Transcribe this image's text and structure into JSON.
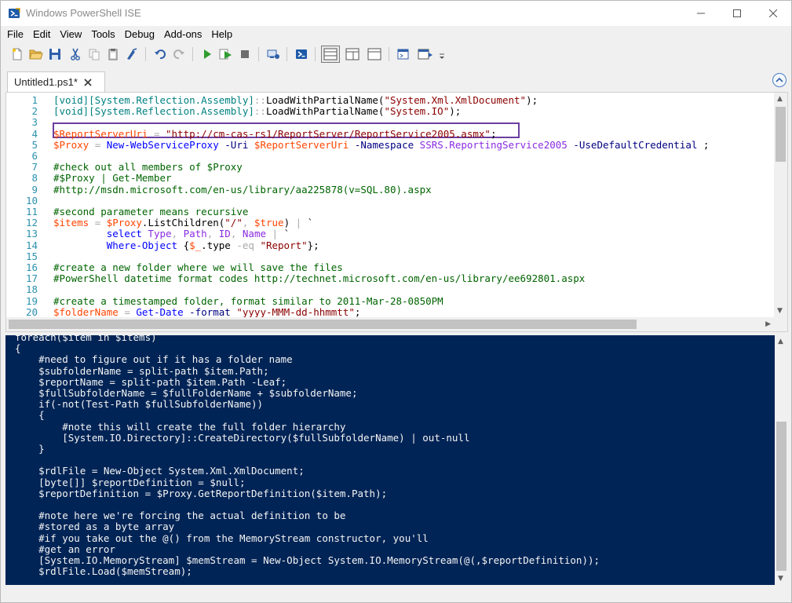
{
  "window": {
    "title": "Windows PowerShell ISE"
  },
  "menu": [
    "File",
    "Edit",
    "View",
    "Tools",
    "Debug",
    "Add-ons",
    "Help"
  ],
  "toolbar": {
    "buttons": [
      {
        "name": "new-file-icon"
      },
      {
        "name": "open-folder-icon"
      },
      {
        "name": "save-icon"
      },
      {
        "name": "cut-icon"
      },
      {
        "name": "copy-icon"
      },
      {
        "name": "paste-icon"
      },
      {
        "name": "clear-console-icon"
      },
      {
        "name": "undo-icon"
      },
      {
        "name": "redo-icon"
      },
      {
        "name": "run-script-icon"
      },
      {
        "name": "run-selection-icon"
      },
      {
        "name": "stop-icon"
      },
      {
        "name": "new-remote-tab-icon"
      },
      {
        "name": "start-powershell-icon"
      },
      {
        "name": "show-script-pane-top-icon"
      },
      {
        "name": "show-script-pane-right-icon"
      },
      {
        "name": "show-script-pane-max-icon"
      },
      {
        "name": "show-command-window-icon"
      },
      {
        "name": "show-command-addon-icon"
      },
      {
        "name": "toolbar-overflow-icon"
      }
    ],
    "colors": {
      "run": "#2e9c2e",
      "stop": "#6e6e6e",
      "ps_blue": "#1e5aa8"
    }
  },
  "tab": {
    "label": "Untitled1.ps1*"
  },
  "editor": {
    "lines": [
      {
        "n": "1",
        "tokens": [
          [
            "t-type",
            "[void]"
          ],
          [
            "t-type",
            "[System.Reflection.Assembly]"
          ],
          [
            "t-op",
            "::"
          ],
          [
            "t-member",
            "LoadWithPartialName("
          ],
          [
            "t-str",
            "\"System.Xml.XmlDocument\""
          ],
          [
            "t-plain",
            ");"
          ]
        ]
      },
      {
        "n": "2",
        "tokens": [
          [
            "t-type",
            "[void]"
          ],
          [
            "t-type",
            "[System.Reflection.Assembly]"
          ],
          [
            "t-op",
            "::"
          ],
          [
            "t-member",
            "LoadWithPartialName("
          ],
          [
            "t-str",
            "\"System.IO\""
          ],
          [
            "t-plain",
            ");"
          ]
        ]
      },
      {
        "n": "3",
        "tokens": []
      },
      {
        "n": "4",
        "tokens": [
          [
            "t-var",
            "$ReportServerUri"
          ],
          [
            "t-plain",
            " "
          ],
          [
            "t-op",
            "="
          ],
          [
            "t-plain",
            " "
          ],
          [
            "t-str",
            "\"http://cm-cas-rs1/ReportServer/ReportService2005.asmx\""
          ],
          [
            "t-plain",
            ";"
          ]
        ]
      },
      {
        "n": "5",
        "tokens": [
          [
            "t-var",
            "$Proxy"
          ],
          [
            "t-plain",
            " "
          ],
          [
            "t-op",
            "="
          ],
          [
            "t-plain",
            " "
          ],
          [
            "t-cmd",
            "New-WebServiceProxy"
          ],
          [
            "t-plain",
            " "
          ],
          [
            "t-param",
            "-Uri"
          ],
          [
            "t-plain",
            " "
          ],
          [
            "t-var",
            "$ReportServerUri"
          ],
          [
            "t-plain",
            " "
          ],
          [
            "t-param",
            "-Namespace"
          ],
          [
            "t-plain",
            " "
          ],
          [
            "t-attr",
            "SSRS.ReportingService2005"
          ],
          [
            "t-plain",
            " "
          ],
          [
            "t-param",
            "-UseDefaultCredential"
          ],
          [
            "t-plain",
            " ;"
          ]
        ]
      },
      {
        "n": "6",
        "tokens": []
      },
      {
        "n": "7",
        "tokens": [
          [
            "t-comment",
            "#check out all members of $Proxy"
          ]
        ]
      },
      {
        "n": "8",
        "tokens": [
          [
            "t-comment",
            "#$Proxy | Get-Member"
          ]
        ]
      },
      {
        "n": "9",
        "tokens": [
          [
            "t-comment",
            "#http://msdn.microsoft.com/en-us/library/aa225878(v=SQL.80).aspx"
          ]
        ]
      },
      {
        "n": "10",
        "tokens": []
      },
      {
        "n": "11",
        "tokens": [
          [
            "t-comment",
            "#second parameter means recursive"
          ]
        ]
      },
      {
        "n": "12",
        "tokens": [
          [
            "t-var",
            "$items"
          ],
          [
            "t-plain",
            " "
          ],
          [
            "t-op",
            "="
          ],
          [
            "t-plain",
            " "
          ],
          [
            "t-var",
            "$Proxy"
          ],
          [
            "t-plain",
            "."
          ],
          [
            "t-member",
            "ListChildren("
          ],
          [
            "t-str",
            "\"/\""
          ],
          [
            "t-op",
            ","
          ],
          [
            "t-plain",
            " "
          ],
          [
            "t-var",
            "$true"
          ],
          [
            "t-plain",
            ") "
          ],
          [
            "t-op",
            "|"
          ],
          [
            "t-plain",
            " `"
          ]
        ]
      },
      {
        "n": "13",
        "tokens": [
          [
            "t-plain",
            "         "
          ],
          [
            "t-cmd",
            "select"
          ],
          [
            "t-plain",
            " "
          ],
          [
            "t-attr",
            "Type"
          ],
          [
            "t-op",
            ","
          ],
          [
            "t-plain",
            " "
          ],
          [
            "t-attr",
            "Path"
          ],
          [
            "t-op",
            ","
          ],
          [
            "t-plain",
            " "
          ],
          [
            "t-attr",
            "ID"
          ],
          [
            "t-op",
            ","
          ],
          [
            "t-plain",
            " "
          ],
          [
            "t-attr",
            "Name"
          ],
          [
            "t-plain",
            " "
          ],
          [
            "t-op",
            "|"
          ],
          [
            "t-plain",
            " `"
          ]
        ]
      },
      {
        "n": "14",
        "tokens": [
          [
            "t-plain",
            "         "
          ],
          [
            "t-cmd",
            "Where-Object"
          ],
          [
            "t-plain",
            " {"
          ],
          [
            "t-var",
            "$_"
          ],
          [
            "t-plain",
            ".type "
          ],
          [
            "t-op",
            "-eq"
          ],
          [
            "t-plain",
            " "
          ],
          [
            "t-str",
            "\"Report\""
          ],
          [
            "t-plain",
            "};"
          ]
        ]
      },
      {
        "n": "15",
        "tokens": []
      },
      {
        "n": "16",
        "tokens": [
          [
            "t-comment",
            "#create a new folder where we will save the files"
          ]
        ]
      },
      {
        "n": "17",
        "tokens": [
          [
            "t-comment",
            "#PowerShell datetime format codes http://technet.microsoft.com/en-us/library/ee692801.aspx"
          ]
        ]
      },
      {
        "n": "18",
        "tokens": []
      },
      {
        "n": "19",
        "tokens": [
          [
            "t-comment",
            "#create a timestamped folder, format similar to 2011-Mar-28-0850PM"
          ]
        ]
      },
      {
        "n": "20",
        "tokens": [
          [
            "t-var",
            "$folderName"
          ],
          [
            "t-plain",
            " "
          ],
          [
            "t-op",
            "="
          ],
          [
            "t-plain",
            " "
          ],
          [
            "t-cmd",
            "Get-Date"
          ],
          [
            "t-plain",
            " "
          ],
          [
            "t-param",
            "-format"
          ],
          [
            "t-plain",
            " "
          ],
          [
            "t-str",
            "\"yyyy-MMM-dd-hhmmtt\""
          ],
          [
            "t-plain",
            ";"
          ]
        ]
      }
    ],
    "colors": {
      "highlight_box": "#6b3fa0"
    }
  },
  "console": {
    "background": "#012456",
    "lines": [
      "foreach($item in $items)",
      "{",
      "    #need to figure out if it has a folder name",
      "    $subfolderName = split-path $item.Path;",
      "    $reportName = split-path $item.Path -Leaf;",
      "    $fullSubfolderName = $fullFolderName + $subfolderName;",
      "    if(-not(Test-Path $fullSubfolderName))",
      "    {",
      "        #note this will create the full folder hierarchy",
      "        [System.IO.Directory]::CreateDirectory($fullSubfolderName) | out-null",
      "    }",
      "",
      "    $rdlFile = New-Object System.Xml.XmlDocument;",
      "    [byte[]] $reportDefinition = $null;",
      "    $reportDefinition = $Proxy.GetReportDefinition($item.Path);",
      "",
      "    #note here we're forcing the actual definition to be",
      "    #stored as a byte array",
      "    #if you take out the @() from the MemoryStream constructor, you'll",
      "    #get an error",
      "    [System.IO.MemoryStream] $memStream = New-Object System.IO.MemoryStream(@(,$reportDefinition));",
      "    $rdlFile.Load($memStream);"
    ]
  }
}
